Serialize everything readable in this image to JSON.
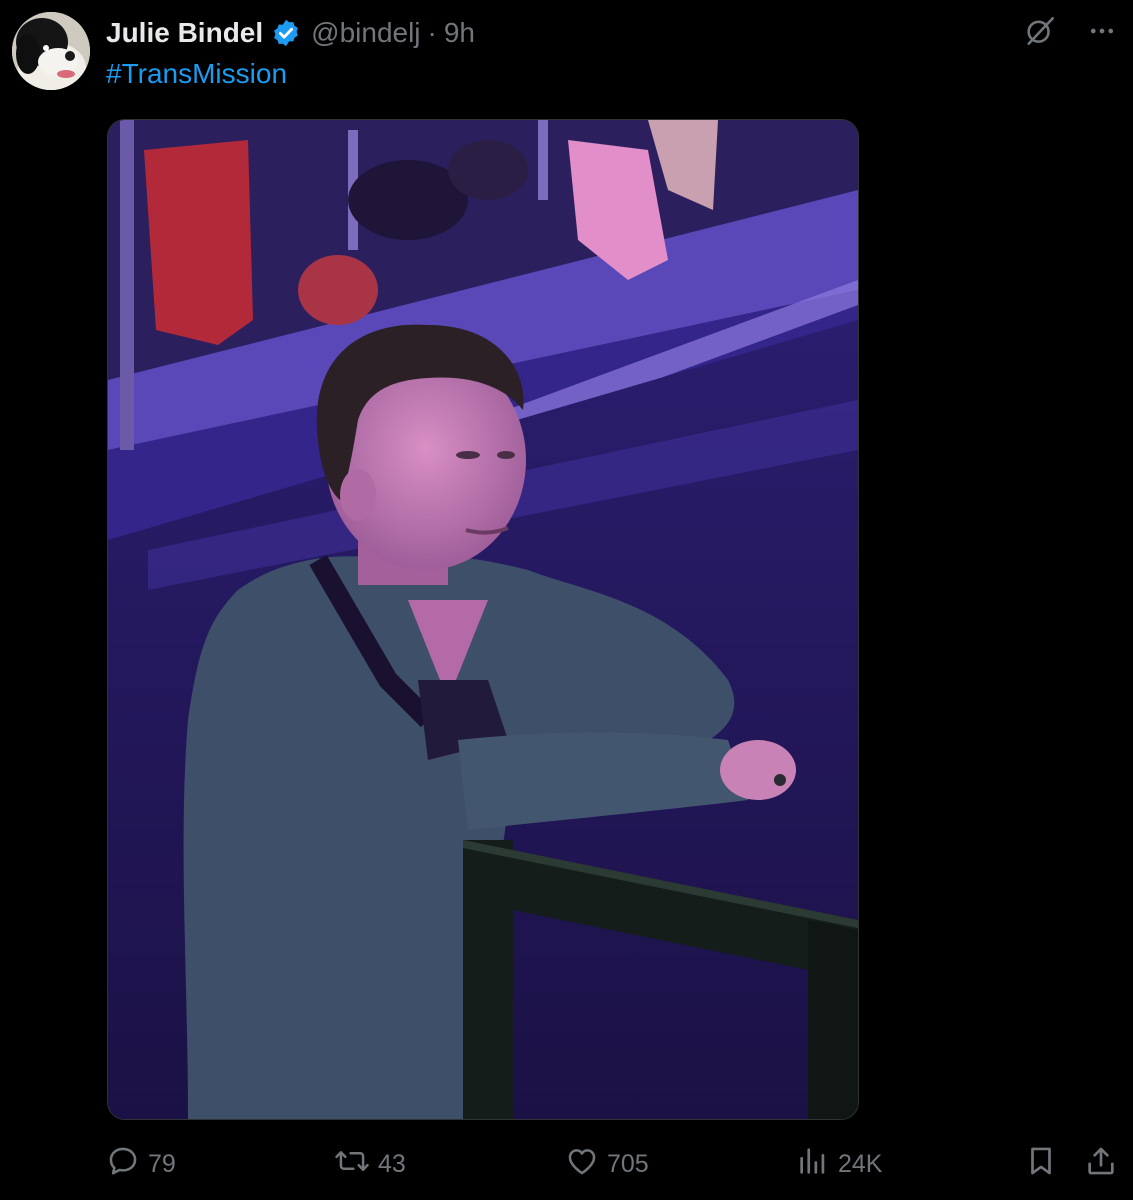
{
  "author": {
    "display_name": "Julie Bindel",
    "handle": "@bindelj",
    "separator": "·",
    "time": "9h",
    "avatar_icon": "dog-avatar",
    "verified_icon": "verified-badge-icon"
  },
  "tweet": {
    "text": "#TransMission"
  },
  "media": {
    "type": "photo"
  },
  "actions": {
    "replies": "79",
    "reposts": "43",
    "likes": "705",
    "views": "24K"
  },
  "colors": {
    "background": "#000000",
    "text": "#e7e9ea",
    "secondary": "#71767b",
    "accent": "#1d9bf0"
  }
}
